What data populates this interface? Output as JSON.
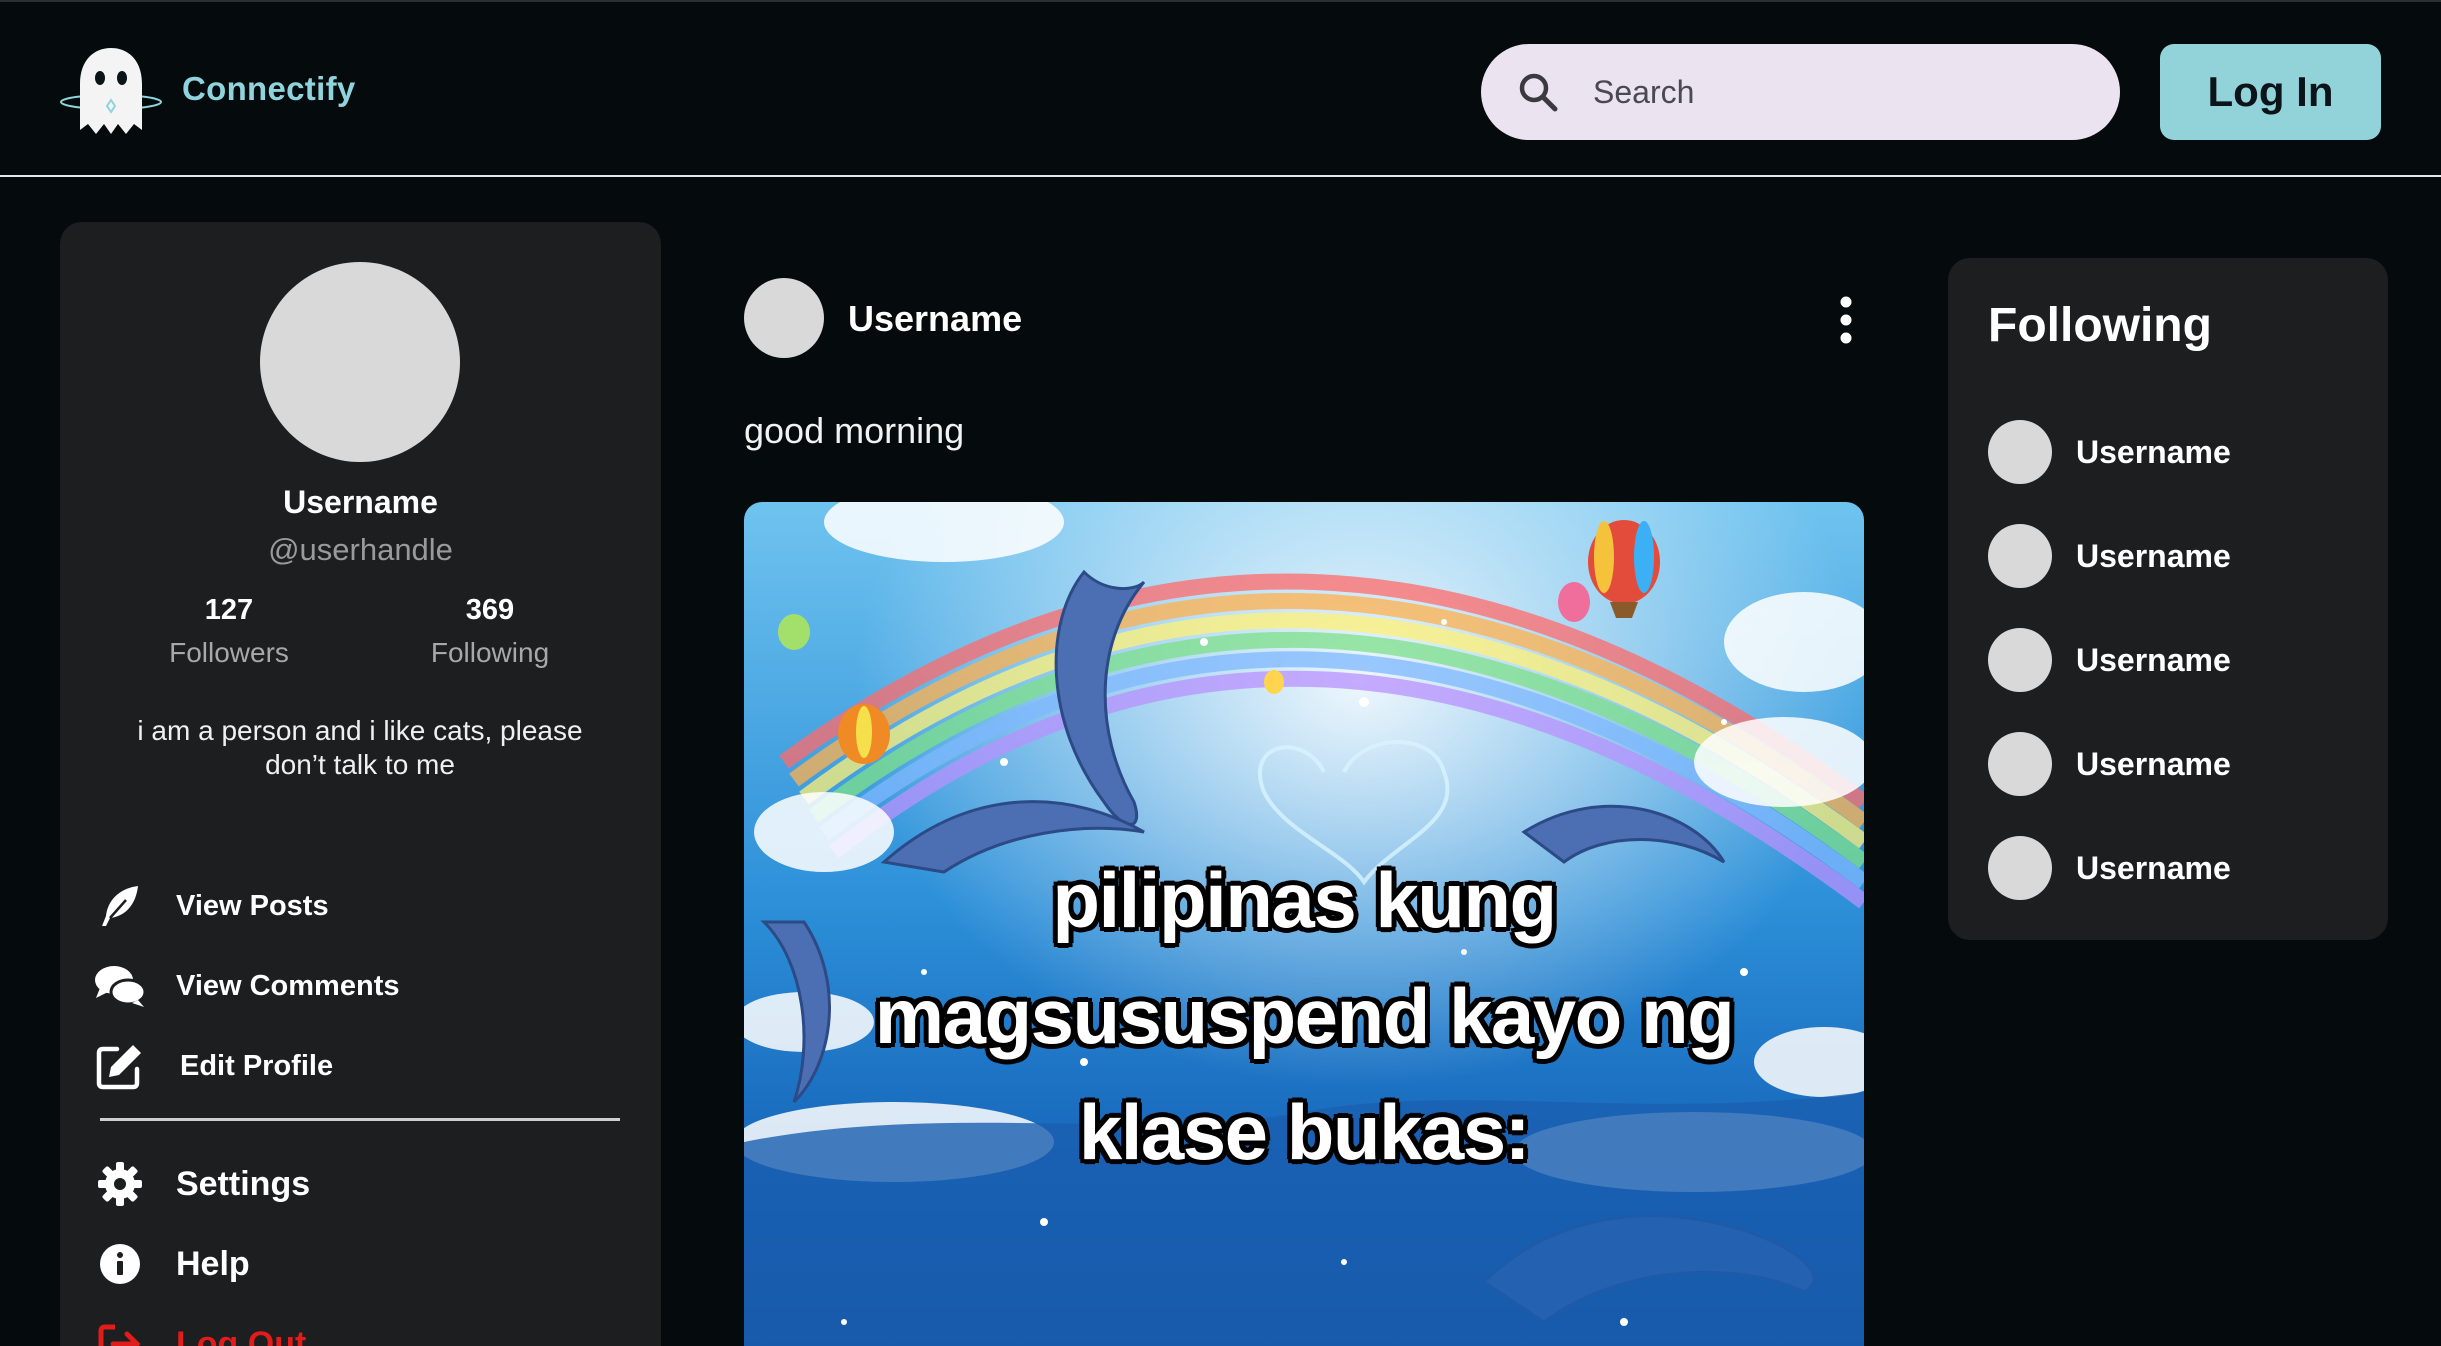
{
  "header": {
    "brand": "Connectify",
    "logo_icon": "ghost-icon",
    "search": {
      "placeholder": "Search",
      "value": ""
    },
    "login_label": "Log In"
  },
  "profile": {
    "name": "Username",
    "handle": "@userhandle",
    "followers": {
      "count": "127",
      "label": "Followers"
    },
    "following": {
      "count": "369",
      "label": "Following"
    },
    "bio_line1": "i am a person and i like cats, please",
    "bio_line2": "don’t talk to me",
    "menu": [
      {
        "label": "View Posts",
        "icon": "feather-icon"
      },
      {
        "label": "View Comments",
        "icon": "comments-icon"
      },
      {
        "label": "Edit Profile",
        "icon": "edit-icon"
      },
      {
        "label": "Settings",
        "icon": "gear-icon"
      },
      {
        "label": "Help",
        "icon": "info-icon"
      },
      {
        "label": "Log Out",
        "icon": "logout-icon"
      }
    ]
  },
  "post": {
    "username": "Username",
    "text": "good morning",
    "image_caption": [
      "pilipinas kung",
      "magsususpend kayo ng",
      "klase bukas:"
    ]
  },
  "following_panel": {
    "title": "Following",
    "users": [
      "Username",
      "Username",
      "Username",
      "Username",
      "Username"
    ]
  },
  "colors": {
    "background": "#050a0c",
    "panel": "#1c1e20",
    "accent": "#92d3da",
    "brand": "#8fd3dc",
    "search_bg": "#ebe3ef",
    "danger": "#e21b1b"
  }
}
